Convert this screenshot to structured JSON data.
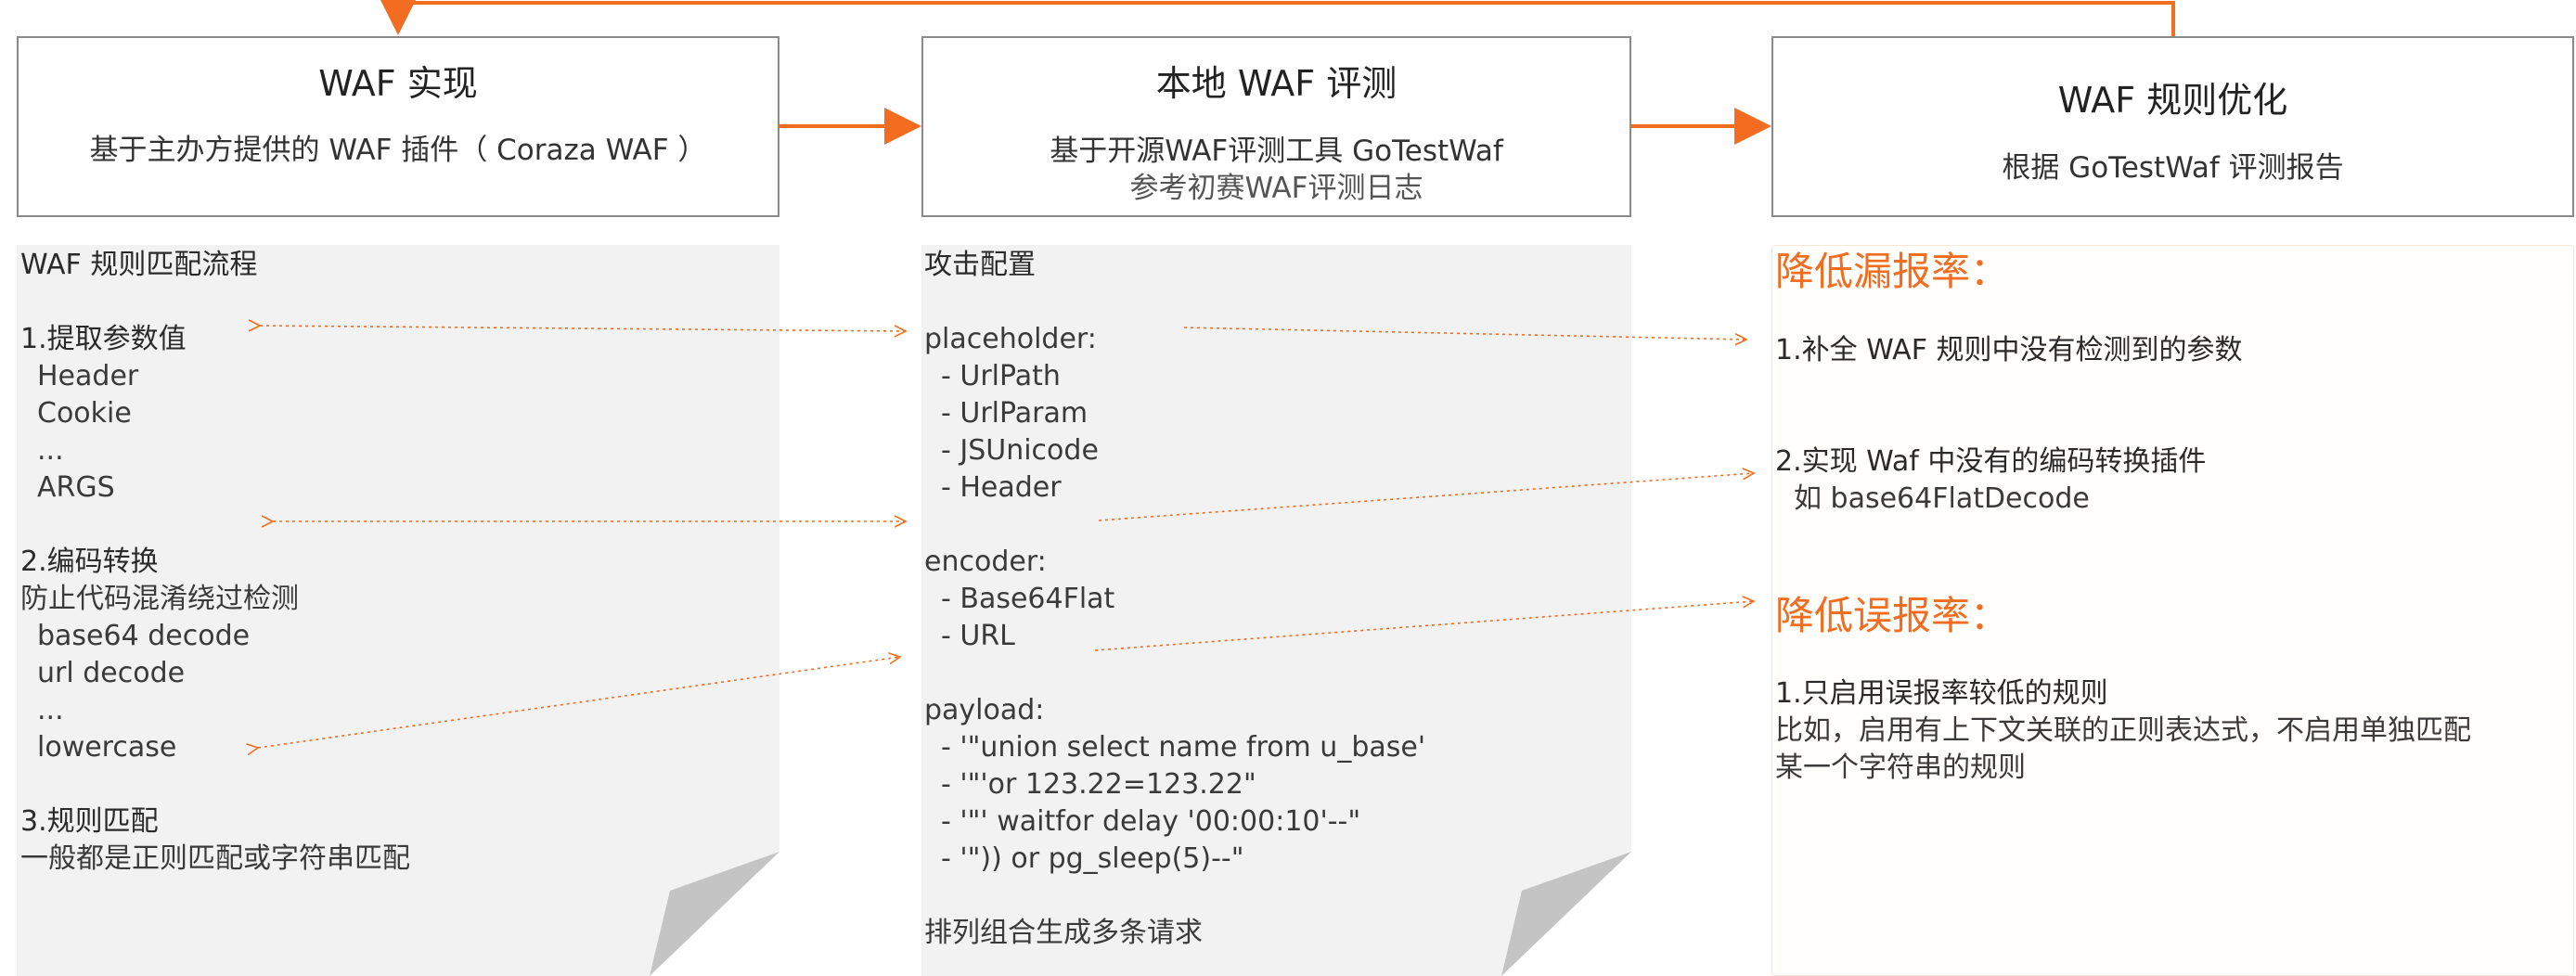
{
  "colors": {
    "accent": "#f26d1f",
    "box_border": "#8a8a8a",
    "note_bg": "#f2f2f2",
    "text": "#3a3a3a"
  },
  "box1": {
    "title": "WAF 实现",
    "sub": "基于主办方提供的 WAF 插件（ Coraza WAF ）"
  },
  "box2": {
    "title": "本地 WAF 评测",
    "sub1": "基于开源WAF评测工具 GoTestWaf",
    "sub2": "参考初赛WAF评测日志"
  },
  "box3": {
    "title": "WAF 规则优化",
    "sub": "根据 GoTestWaf 评测报告"
  },
  "note1": {
    "heading": "WAF 规则匹配流程",
    "step1": "1.提取参数值",
    "step1_items": [
      "Header",
      "Cookie",
      "...",
      "ARGS"
    ],
    "step2": "2.编码转换",
    "step2_desc": "防止代码混淆绕过检测",
    "step2_items": [
      "base64 decode",
      "url decode",
      "...",
      "lowercase"
    ],
    "step3": "3.规则匹配",
    "step3_desc": "一般都是正则匹配或字符串匹配"
  },
  "note2": {
    "heading": "攻击配置",
    "placeholder_label": "placeholder:",
    "placeholder_items": [
      "- UrlPath",
      "- UrlParam",
      "- JSUnicode",
      "- Header"
    ],
    "encoder_label": "encoder:",
    "encoder_items": [
      "- Base64Flat",
      "- URL"
    ],
    "payload_label": "payload:",
    "payload_items": [
      "- '\"union select name from u_base'",
      "- '\"'or 123.22=123.22\"",
      "- '\"' waitfor delay '00:00:10'--\"",
      "- '\")) or pg_sleep(5)--\""
    ],
    "footer": "排列组合生成多条请求"
  },
  "panel3": {
    "head1": "降低漏报率：",
    "item1": "1.补全 WAF 规则中没有检测到的参数",
    "item2": "2.实现 Waf 中没有的编码转换插件",
    "item2_example": "如 base64FlatDecode",
    "head2": "降低误报率：",
    "item3": "1.只启用误报率较低的规则",
    "item3_desc1": "比如，启用有上下文关联的正则表达式，不启用单独匹配",
    "item3_desc2": "某一个字符串的规则"
  }
}
